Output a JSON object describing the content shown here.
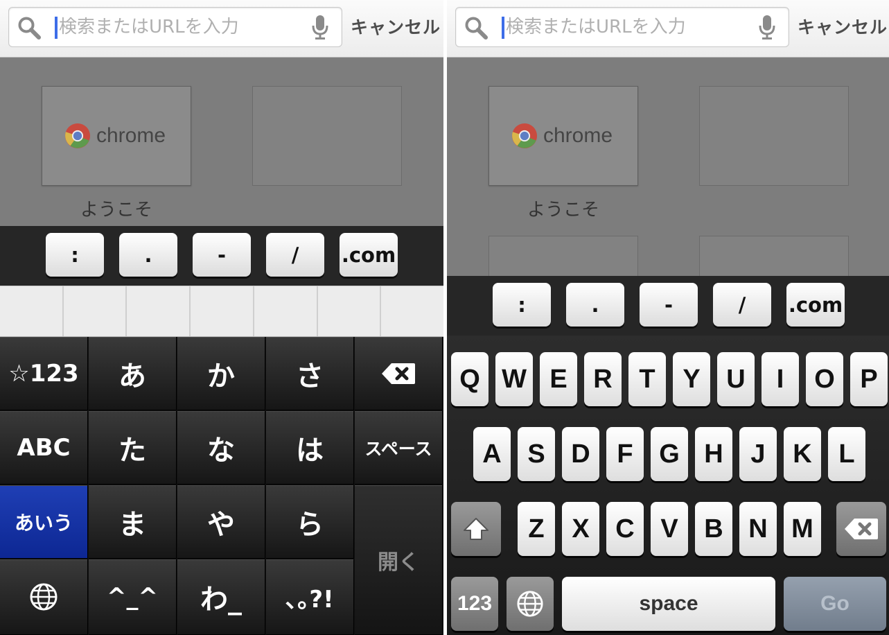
{
  "search": {
    "placeholder": "検索またはURLを入力",
    "cancel_label": "キャンセル"
  },
  "new_tab": {
    "tile_brand": "chrome",
    "tile_caption": "ようこそ"
  },
  "url_keys": [
    ":",
    ".",
    "-",
    "/",
    ".com"
  ],
  "kana_keyboard": {
    "row1": [
      "☆123",
      "あ",
      "か",
      "さ"
    ],
    "row2": [
      "ABC",
      "た",
      "な",
      "は",
      "スペース"
    ],
    "row3": [
      "あいう",
      "ま",
      "や",
      "ら"
    ],
    "row4": [
      "^_^",
      "わ_",
      "､｡?!"
    ],
    "open_label": "開く"
  },
  "qwerty_keyboard": {
    "row1": [
      "Q",
      "W",
      "E",
      "R",
      "T",
      "Y",
      "U",
      "I",
      "O",
      "P"
    ],
    "row2": [
      "A",
      "S",
      "D",
      "F",
      "G",
      "H",
      "J",
      "K",
      "L"
    ],
    "row3": [
      "Z",
      "X",
      "C",
      "V",
      "B",
      "N",
      "M"
    ],
    "num_label": "123",
    "space_label": "space",
    "go_label": "Go"
  },
  "colors": {
    "caret": "#3d6de8",
    "active_kana_key": "#1f3fb5",
    "go_key": "#8390a0"
  }
}
